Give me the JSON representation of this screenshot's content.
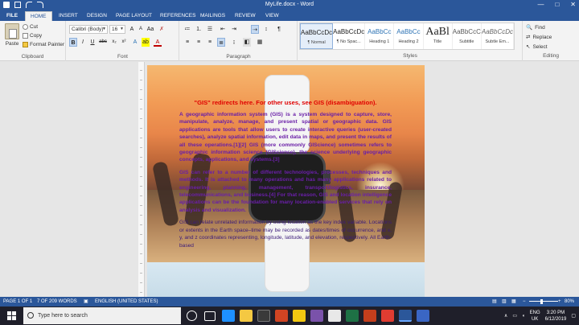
{
  "window": {
    "title": "MyLife.docx - Word",
    "controls": [
      "—",
      "□",
      "✕"
    ]
  },
  "tabs": [
    "FILE",
    "HOME",
    "INSERT",
    "DESIGN",
    "PAGE LAYOUT",
    "REFERENCES",
    "MAILINGS",
    "REVIEW",
    "VIEW"
  ],
  "ribbon": {
    "clipboard": {
      "paste": "Paste",
      "cut": "Cut",
      "copy": "Copy",
      "format_painter": "Format Painter",
      "label": "Clipboard"
    },
    "font": {
      "name": "Calibri (Body)",
      "size": "16",
      "label": "Font"
    },
    "paragraph": {
      "label": "Paragraph"
    },
    "styles": {
      "label": "Styles",
      "items": [
        {
          "preview": "AaBbCcDc",
          "name": "¶ Normal",
          "kind": "normal"
        },
        {
          "preview": "AaBbCcDc",
          "name": "¶ No Spac...",
          "kind": "normal"
        },
        {
          "preview": "AaBbCc",
          "name": "Heading 1",
          "kind": "h"
        },
        {
          "preview": "AaBbCc",
          "name": "Heading 2",
          "kind": "h"
        },
        {
          "preview": "AaBl",
          "name": "Title",
          "kind": "title"
        },
        {
          "preview": "AaBbCcC",
          "name": "Subtitle",
          "kind": "normal"
        },
        {
          "preview": "AaBbCcDc",
          "name": "Subtle Em...",
          "kind": "normal"
        }
      ]
    },
    "editing": {
      "find": "Find",
      "replace": "Replace",
      "select": "Select",
      "label": "Editing"
    }
  },
  "document": {
    "hatnote": "\"GIS\" redirects here. For other uses, see GIS (disambiguation).",
    "p1": "A geographic information system (GIS) is a system designed to capture, store, manipulate, analyze, manage, and present spatial or geographic data. GIS applications are tools that allow users to create interactive queries (user-created searches), analyze spatial information, edit data in maps, and present the results of all these operations.[1][2] GIS (more commonly GIScience) sometimes refers to geographic information science (GIScience), the science underlying geographic concepts, applications, and systems.[3]",
    "p2": "GIS can refer to a number of different technologies, processes, techniques and methods. It is attached to many operations and has many applications related to engineering, planning, management, transport/logistics, insurance, telecommunications, and business.[4] For that reason, GIS and location intelligence applications can be the foundation for many location-enabled services that rely on analysis and visualization.",
    "p3": "GIS can relate unrelated information by using location as the key index variable. Locations or extents in the Earth space–time may be recorded as dates/times of occurrence, and x, y, and z coordinates representing, longitude, latitude, and elevation, respectively. All Earth-based"
  },
  "status": {
    "page": "PAGE 1 OF 1",
    "words": "7 OF 209 WORDS",
    "language": "ENGLISH (UNITED STATES)",
    "zoom": "80%"
  },
  "taskbar": {
    "search_placeholder": "Type here to search",
    "lang1": "ENG",
    "lang2": "UK",
    "time": "3:20 PM",
    "date": "6/12/2019"
  }
}
